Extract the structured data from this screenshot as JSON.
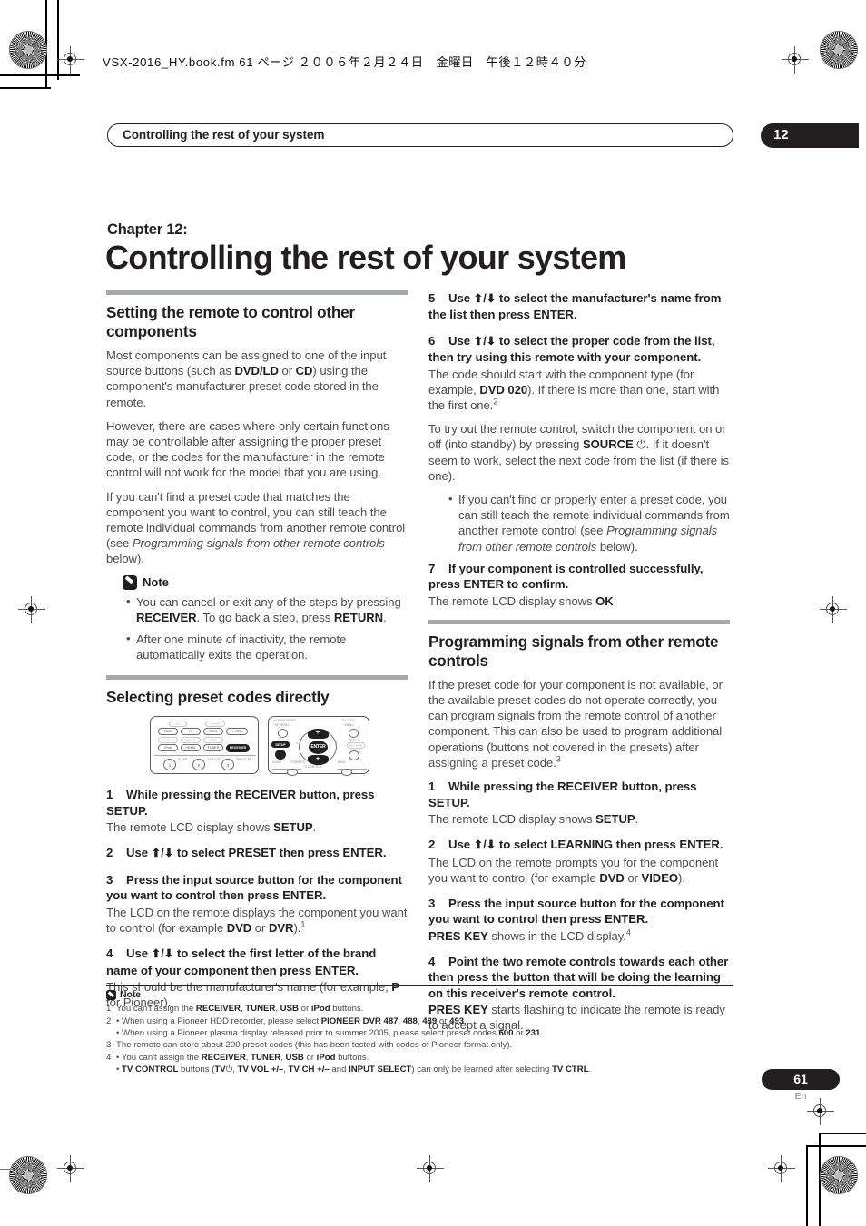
{
  "fm_header": "VSX-2016_HY.book.fm 61 ページ ２００６年２月２４日　金曜日　午後１２時４０分",
  "running_head": "Controlling the rest of your system",
  "chapter_tab": "12",
  "chapter_label": "Chapter 12:",
  "chapter_title": "Controlling the rest of your system",
  "colors": {
    "rule": "#a7a9ac",
    "ink": "#231f20",
    "body": "#4c4c4e"
  },
  "left_column": {
    "section1_heading": "Setting the remote to control other components",
    "p1_html": "Most components can be assigned to one of the input source buttons (such as <b>DVD/LD</b> or <b>CD</b>) using the component's manufacturer preset code stored in the remote.",
    "p2_html": "However, there are cases where only certain functions may be controllable after assigning the proper preset code, or the codes for the manufacturer in the remote control will not work for the model that you are using.",
    "p3_html": "If you can't find a preset code that matches the component you want to control, you can still teach the remote individual commands from another remote control (see <i>Programming signals from other remote controls</i> below).",
    "note_title": "Note",
    "note_bullets_html": [
      "You can cancel or exit any of the steps by pressing <b>RECEIVER</b>. To go back a step, press <b>RETURN</b>.",
      "After one minute of inactivity, the remote automatically exits the operation."
    ],
    "section2_heading": "Selecting preset codes directly",
    "steps": [
      {
        "num": "1",
        "text_html": "While pressing the RECEIVER button, press SETUP.",
        "body_html": "The remote LCD display shows <b>SETUP</b>."
      },
      {
        "num": "2",
        "text_html": "Use <span class=\"arrows\">&#11014;/&#11015;</span> to select PRESET then press ENTER.",
        "body_html": ""
      },
      {
        "num": "3",
        "text_html": "Press the input source button for the component you want to control then press ENTER.",
        "body_html": "The LCD on the remote displays the component you want to control (for example <b>DVD</b> or <b>DVR</b>).<sup>1</sup>"
      },
      {
        "num": "4",
        "text_html": "Use <span class=\"arrows\">&#11014;/&#11015;</span> to select the first letter of the brand name of your component then press ENTER.",
        "body_html": "This should be the manufacturer's name (for example, <b>P</b> for Pioneer)."
      }
    ]
  },
  "right_column": {
    "steps_top": [
      {
        "num": "5",
        "text_html": "Use <span class=\"arrows\">&#11014;/&#11015;</span> to select the manufacturer's name from the list then press ENTER.",
        "body_html": ""
      },
      {
        "num": "6",
        "text_html": "Use <span class=\"arrows\">&#11014;/&#11015;</span> to select the proper code from the list, then try using this remote with your component.",
        "body_html": "The code should start with the component type (for example, <b>DVD 020</b>). If there is more than one, start with the first one.<sup>2</sup>"
      }
    ],
    "p_tryout_html": "To try out the remote control, switch the component on or off (into standby) by pressing <b>SOURCE</b> &#9211;. If it doesn't seem to work, select the next code from the list (if there is one).",
    "bullet_html": "If you can't find or properly enter a preset code, you can still teach the remote individual commands from another remote control (see <i>Programming signals from other remote controls</i> below).",
    "step7": {
      "num": "7",
      "text_html": "If your component is controlled successfully, press ENTER to confirm.",
      "body_html": "The remote LCD display shows <b>OK</b>."
    },
    "section_heading": "Programming signals from other remote controls",
    "section_intro_html": "If the preset code for your component is not available, or the available preset codes do not operate correctly, you can program signals from the remote control of another component. This can also be used to program additional operations (buttons not covered in the presets) after assigning a preset code.<sup>3</sup>",
    "steps": [
      {
        "num": "1",
        "text_html": "While pressing the RECEIVER button, press SETUP.",
        "body_html": "The remote LCD display shows <b>SETUP</b>."
      },
      {
        "num": "2",
        "text_html": "Use <span class=\"arrows\">&#11014;/&#11015;</span> to select LEARNING then press ENTER.",
        "body_html": "The LCD on the remote prompts you for the component you want to control (for example <b>DVD</b> or <b>VIDEO</b>)."
      },
      {
        "num": "3",
        "text_html": "Press the input source button for the component you want to control then press ENTER.",
        "body_html": "<b>PRES KEY</b> shows in the LCD display.<sup>4</sup>"
      },
      {
        "num": "4",
        "text_html": "Point the two remote controls towards each other then press the button that will be doing the learning on this receiver's remote control.",
        "body_html": "<b>PRES KEY</b> starts flashing to indicate the remote is ready to accept a signal."
      }
    ]
  },
  "remote_figure": {
    "left_unit_buttons": [
      "CD",
      "DVR2",
      "DVD",
      "TV",
      "DVR1",
      "TV CTRL",
      "CD-R/T",
      "MULTI",
      "USB",
      "iPod",
      "HDMI1",
      "TUNER",
      "RECEIVER"
    ],
    "left_unit_numbers": [
      "1",
      "2",
      "3"
    ],
    "left_unit_number_labels": [
      "SLEEP",
      "VIDEO SEL",
      "DIRECT BT"
    ],
    "right_unit_labels": [
      "AV PARAMETER",
      "TOP MENU",
      "CH LEVEL",
      "MENU",
      "SETUP",
      "GUIDE",
      "TV/DIRECT",
      "TEST",
      "RETURN",
      "BAND",
      "TV CONTROL"
    ],
    "right_unit_enter": "ENTER",
    "right_unit_highlighted": "SETUP"
  },
  "footnotes": {
    "title": "Note",
    "rows": [
      {
        "num": "1",
        "sub": false,
        "html": "You can't assign the <b>RECEIVER</b>, <b>TUNER</b>, <b>USB</b> or <b>iPod</b> buttons."
      },
      {
        "num": "2",
        "sub": false,
        "html": "&bull; When using a Pioneer HDD recorder, please select <b>PIONEER DVR 487</b>, <b>488</b>, <b>489</b> or <b>493</b>."
      },
      {
        "num": "",
        "sub": true,
        "html": "&bull; When using a Pioneer plasma display released prior to summer 2005, please select preset codes <b>600</b> or <b>231</b>."
      },
      {
        "num": "3",
        "sub": false,
        "html": "The remote can store about 200 preset codes (this has been tested with codes of Pioneer format only)."
      },
      {
        "num": "4",
        "sub": false,
        "html": "&bull; You can't assign the <b>RECEIVER</b>, <b>TUNER</b>, <b>USB</b> or <b>iPod</b> buttons."
      },
      {
        "num": "",
        "sub": true,
        "html": "&bull; <b>TV CONTROL</b> buttons (<b>TV</b>&#9211;, <b>TV VOL +/&ndash;</b>, <b>TV CH +/&ndash;</b> and <b>INPUT SELECT</b>) can only be learned after selecting <b>TV CTRL</b>."
      }
    ]
  },
  "page_number": "61",
  "page_language": "En"
}
